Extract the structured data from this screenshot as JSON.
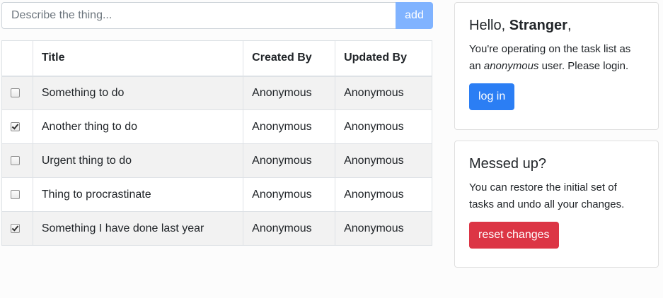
{
  "add_form": {
    "placeholder": "Describe the thing...",
    "value": "",
    "button_label": "add"
  },
  "table": {
    "headers": {
      "title": "Title",
      "created_by": "Created By",
      "updated_by": "Updated By"
    },
    "rows": [
      {
        "checked": false,
        "title": "Something to do",
        "created_by": "Anonymous",
        "updated_by": "Anonymous"
      },
      {
        "checked": true,
        "title": "Another thing to do",
        "created_by": "Anonymous",
        "updated_by": "Anonymous"
      },
      {
        "checked": false,
        "title": "Urgent thing to do",
        "created_by": "Anonymous",
        "updated_by": "Anonymous"
      },
      {
        "checked": false,
        "title": "Thing to procrastinate",
        "created_by": "Anonymous",
        "updated_by": "Anonymous"
      },
      {
        "checked": true,
        "title": "Something I have done last year",
        "created_by": "Anonymous",
        "updated_by": "Anonymous"
      }
    ]
  },
  "login_card": {
    "greeting": "Hello, ",
    "user_name": "Stranger",
    "greeting_suffix": ",",
    "text_before": "You're operating on the task list as an ",
    "text_emphasis": "anonymous",
    "text_after": " user. Please login.",
    "button_label": "log in"
  },
  "reset_card": {
    "title": "Messed up?",
    "text": "You can restore the initial set of tasks and undo all your changes.",
    "button_label": "reset changes"
  },
  "colors": {
    "primary": "#2b7ef4",
    "danger": "#dc3545",
    "add_button": "#80b3ff"
  }
}
